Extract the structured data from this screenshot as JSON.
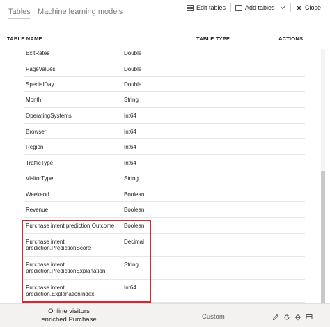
{
  "tabs": [
    {
      "label": "Tables",
      "active": true
    },
    {
      "label": "Machine learning models",
      "active": false
    }
  ],
  "toolbar": {
    "edit_label": "Edit tables",
    "add_label": "Add tables",
    "close_label": "Close",
    "chevron_icon": "chevron-down-icon",
    "edit_icon": "table-edit-icon",
    "add_icon": "table-add-icon",
    "close_icon": "close-icon"
  },
  "columns": {
    "name": "TABLE NAME",
    "type": "TABLE TYPE",
    "actions": "ACTIONS"
  },
  "rows": [
    {
      "name": "ExitRates",
      "type": "Double"
    },
    {
      "name": "PageValues",
      "type": "Double"
    },
    {
      "name": "SpecialDay",
      "type": "Double"
    },
    {
      "name": "Month",
      "type": "String"
    },
    {
      "name": "OperatingSystems",
      "type": "Int64"
    },
    {
      "name": "Browser",
      "type": "Int64"
    },
    {
      "name": "Region",
      "type": "Int64"
    },
    {
      "name": "TrafficType",
      "type": "Int64"
    },
    {
      "name": "VisitorType",
      "type": "String"
    },
    {
      "name": "Weekend",
      "type": "Boolean"
    },
    {
      "name": "Revenue",
      "type": "Boolean"
    },
    {
      "name": "Purchase intent prediction.Outcome",
      "type": "Boolean"
    },
    {
      "name_line1": "Purchase intent",
      "name_line2": "prediction.PredictionScore",
      "type": "Decimal"
    },
    {
      "name_line1": "Purchase intent",
      "name_line2": "prediction.PredictionExplanation",
      "type": "String"
    },
    {
      "name_line1": "Purchase intent",
      "name_line2": "prediction.ExplanationIndex",
      "type": "Int64"
    }
  ],
  "footer": {
    "table_line1": "Online visitors",
    "table_line2": "enriched Purchase",
    "table_type": "Custom",
    "action_icons": [
      "edit-icon",
      "refresh-icon",
      "settings-icon",
      "more-icon"
    ]
  },
  "colors": {
    "highlight": "#d9262c",
    "footer_bg": "#f3f2f1"
  }
}
